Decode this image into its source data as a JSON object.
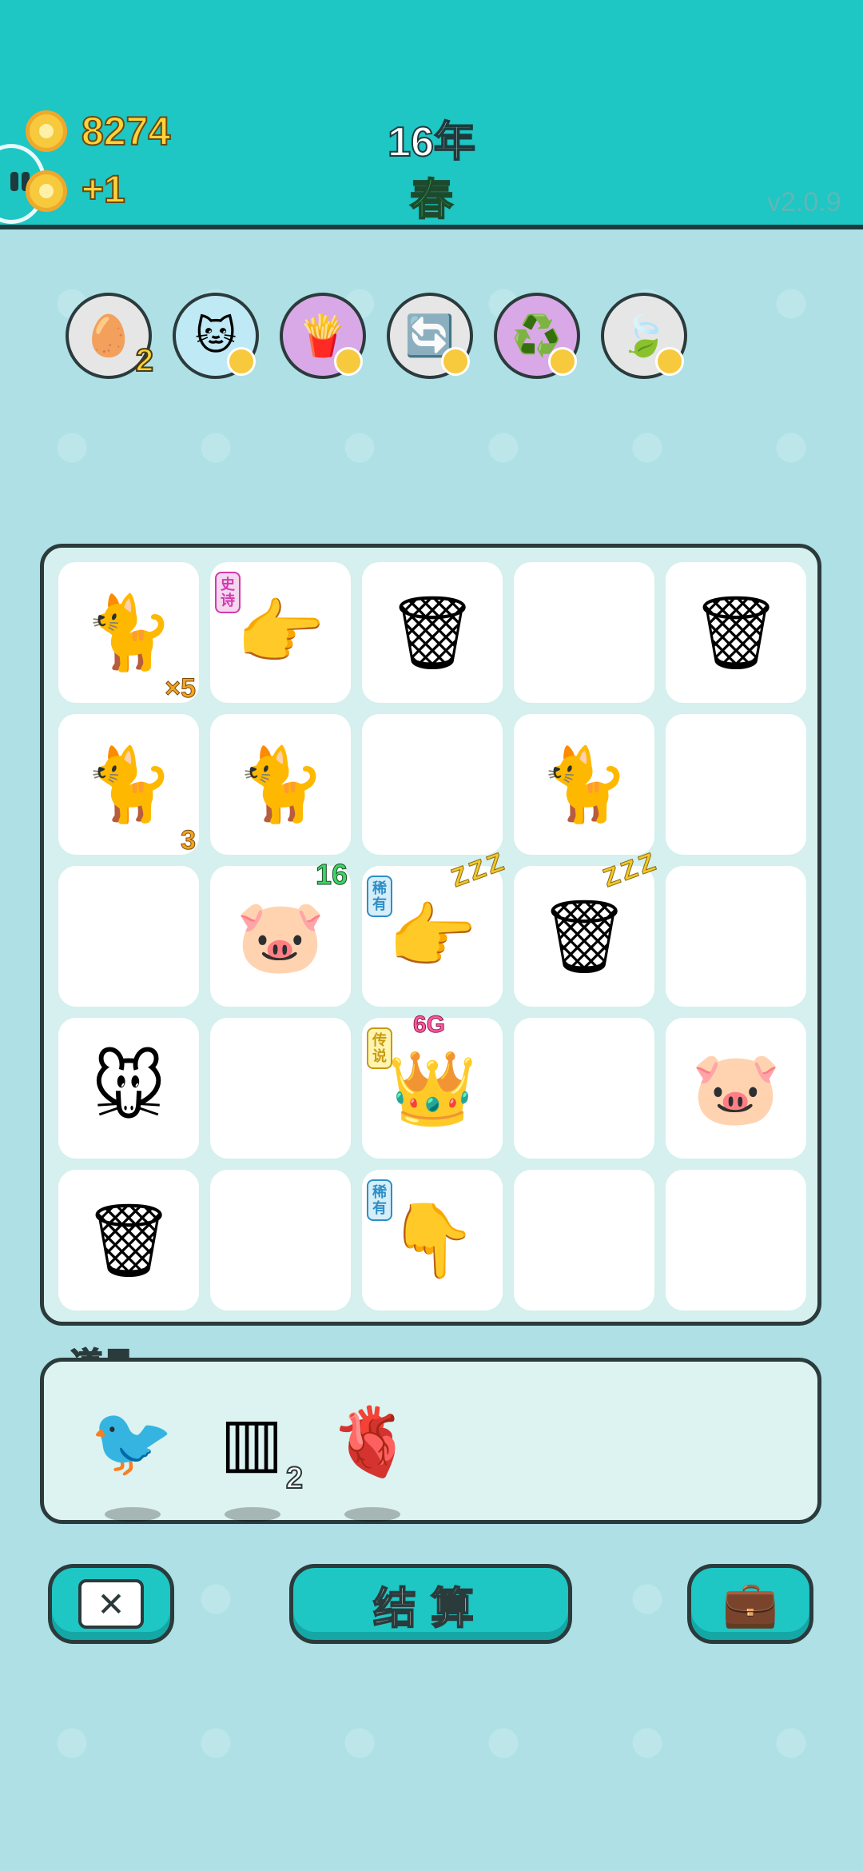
{
  "header": {
    "money": "8274",
    "income": "+1",
    "year": "16年",
    "season": "春",
    "version": "v2.0.9"
  },
  "effects": [
    {
      "icon": "egg-carton-icon",
      "glyph": "🥚",
      "bg": "#e6e6e6",
      "badge": "2"
    },
    {
      "icon": "cat-face-icon",
      "glyph": "🐱",
      "bg": "#bfe9f4",
      "badge": ""
    },
    {
      "icon": "fries-icon",
      "glyph": "🍟",
      "bg": "#d9a8e6",
      "badge": ""
    },
    {
      "icon": "refresh-icon",
      "glyph": "🔄",
      "bg": "#e6e6e6",
      "badge": ""
    },
    {
      "icon": "recycle-icon",
      "glyph": "♻️",
      "bg": "#d9a8e6",
      "badge": ""
    },
    {
      "icon": "leaf-icon",
      "glyph": "🍃",
      "bg": "#e6e6e6",
      "badge": ""
    }
  ],
  "board": [
    [
      {
        "name": "cat",
        "glyph": "🐈",
        "count": "×5"
      },
      {
        "name": "pointing-hand",
        "glyph": "👉",
        "tag": "史诗",
        "tagType": "epic"
      },
      {
        "name": "garbage-bag",
        "glyph": "🗑"
      },
      {
        "name": "empty"
      },
      {
        "name": "garbage-bag",
        "glyph": "🗑"
      }
    ],
    [
      {
        "name": "cat",
        "glyph": "🐈",
        "count": "3"
      },
      {
        "name": "cat",
        "glyph": "🐈"
      },
      {
        "name": "empty"
      },
      {
        "name": "cat",
        "glyph": "🐈"
      },
      {
        "name": "empty"
      }
    ],
    [
      {
        "name": "empty"
      },
      {
        "name": "pig",
        "glyph": "🐷",
        "countTop": "16"
      },
      {
        "name": "pointing-hand",
        "glyph": "👉",
        "tag": "稀有",
        "tagType": "rare",
        "zzz": "ZZZ"
      },
      {
        "name": "garbage-bag",
        "glyph": "🗑",
        "zzz": "ZZZ"
      },
      {
        "name": "empty"
      }
    ],
    [
      {
        "name": "mouse",
        "glyph": "🐭"
      },
      {
        "name": "empty"
      },
      {
        "name": "king",
        "glyph": "👑",
        "tag": "传说",
        "tagType": "legend",
        "level": "6G"
      },
      {
        "name": "empty"
      },
      {
        "name": "pig",
        "glyph": "🐷"
      }
    ],
    [
      {
        "name": "garbage-bag",
        "glyph": "🗑"
      },
      {
        "name": "empty"
      },
      {
        "name": "pointing-hand",
        "glyph": "👇",
        "tag": "稀有",
        "tagType": "rare"
      },
      {
        "name": "empty"
      },
      {
        "name": "empty"
      }
    ]
  ],
  "items": {
    "label": "道具",
    "list": [
      {
        "name": "bird",
        "glyph": "🐦",
        "count": ""
      },
      {
        "name": "cage",
        "glyph": "▥",
        "count": "2"
      },
      {
        "name": "liver",
        "glyph": "🫀",
        "count": ""
      }
    ]
  },
  "buttons": {
    "close": "✕",
    "settle": "结算",
    "bag": "💼"
  }
}
